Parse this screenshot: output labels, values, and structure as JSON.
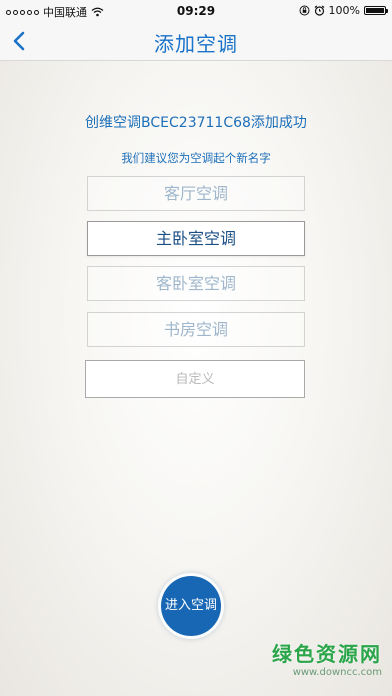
{
  "status_bar": {
    "carrier": "中国联通",
    "time": "09:29",
    "battery_text": "100%",
    "battery_level": 1.0,
    "icons": [
      "signal-icon",
      "wifi-icon",
      "rotation-lock-icon",
      "alarm-icon",
      "battery-icon"
    ]
  },
  "nav": {
    "title": "添加空调",
    "back_icon": "chevron-left-icon",
    "accent": "#1a73c8"
  },
  "content": {
    "success_message": "创维空调BCEC23711C68添加成功",
    "suggestion": "我们建议您为空调起个新名字",
    "options": [
      {
        "label": "客厅空调",
        "selected": false
      },
      {
        "label": "主卧室空调",
        "selected": true
      },
      {
        "label": "客卧室空调",
        "selected": false
      },
      {
        "label": "书房空调",
        "selected": false
      }
    ],
    "custom_placeholder": "自定义",
    "enter_button": "进入空调"
  },
  "watermark": {
    "text": "绿色资源网",
    "url": "www.downcc.com"
  }
}
